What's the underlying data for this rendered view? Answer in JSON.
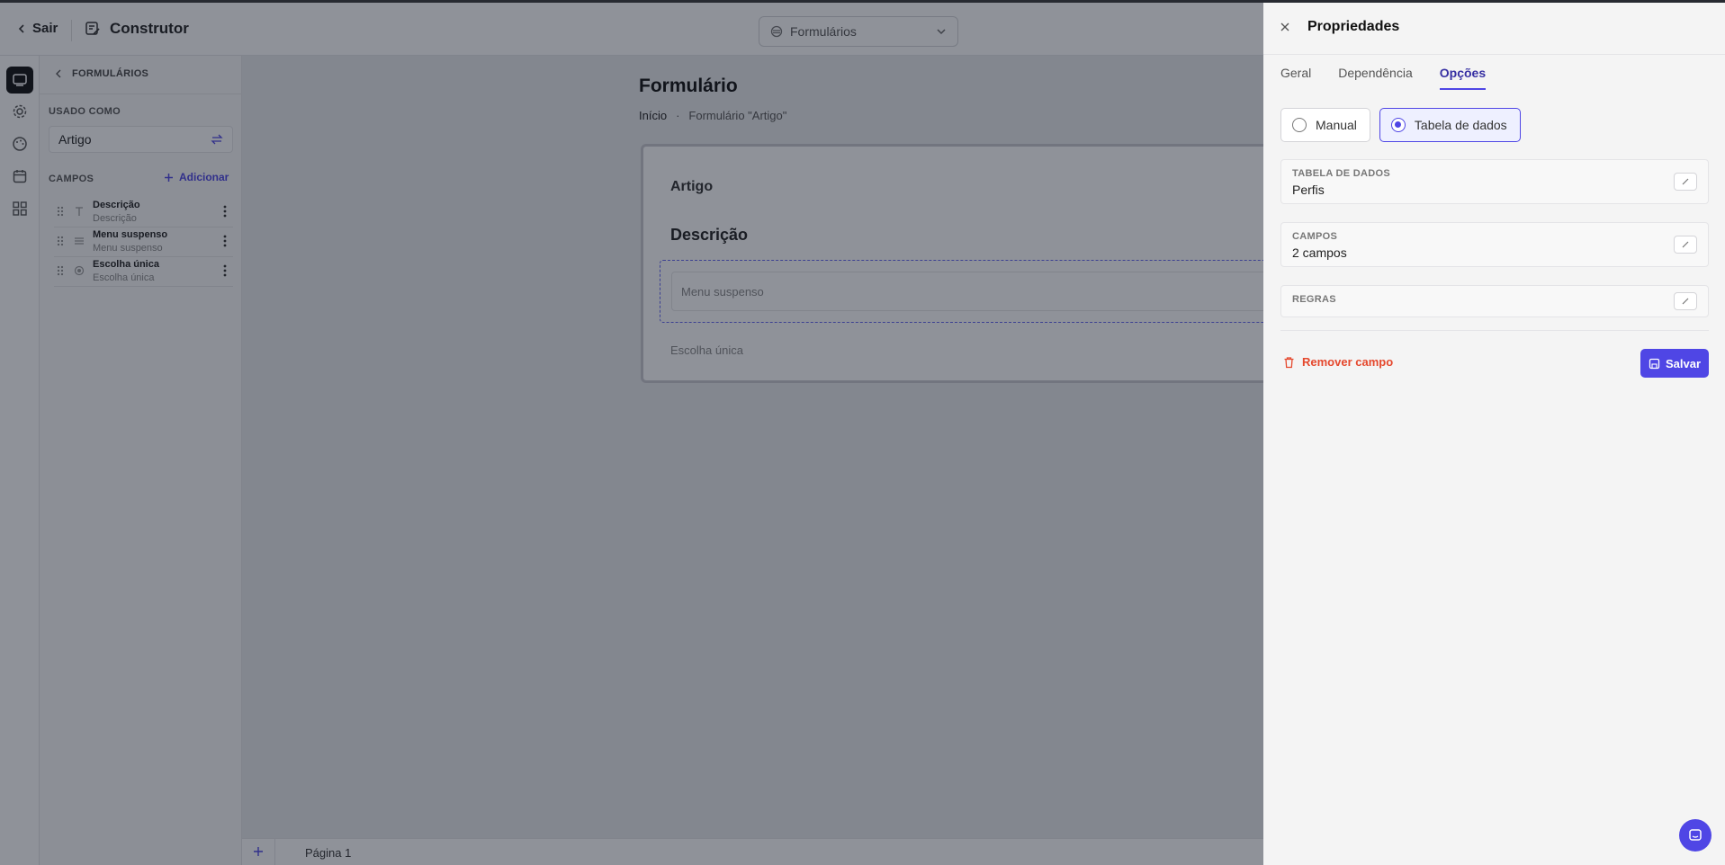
{
  "header": {
    "exit_label": "Sair",
    "title": "Construtor",
    "selector_value": "Formulários"
  },
  "sidebar": {
    "back_label": "FORMULÁRIOS",
    "used_as_label": "USADO COMO",
    "used_as_value": "Artigo",
    "fields_label": "CAMPOS",
    "add_label": "Adicionar",
    "fields": [
      {
        "name": "Descrição",
        "subtitle": "Descrição"
      },
      {
        "name": "Menu suspenso",
        "subtitle": "Menu suspenso"
      },
      {
        "name": "Escolha única",
        "subtitle": "Escolha única"
      }
    ]
  },
  "canvas": {
    "title": "Formulário",
    "breadcrumb": [
      "Início",
      "Formulário \"Artigo\""
    ],
    "card": {
      "heading": "Artigo",
      "section": "Descrição",
      "dropdown_placeholder": "Menu suspenso",
      "single_choice": "Escolha única"
    },
    "page_label": "Página 1"
  },
  "panel": {
    "title": "Propriedades",
    "tabs": [
      {
        "label": "Geral",
        "active": false
      },
      {
        "label": "Dependência",
        "active": false
      },
      {
        "label": "Opções",
        "active": true
      }
    ],
    "source_options": [
      {
        "label": "Manual",
        "selected": false
      },
      {
        "label": "Tabela de dados",
        "selected": true
      }
    ],
    "rows": [
      {
        "label": "TABELA DE DADOS",
        "value": "Perfis"
      },
      {
        "label": "CAMPOS",
        "value": "2 campos"
      },
      {
        "label": "REGRAS",
        "value": ""
      }
    ],
    "remove_label": "Remover campo",
    "save_label": "Salvar"
  },
  "colors": {
    "accent": "#4f46e5",
    "danger": "#e5482d"
  }
}
